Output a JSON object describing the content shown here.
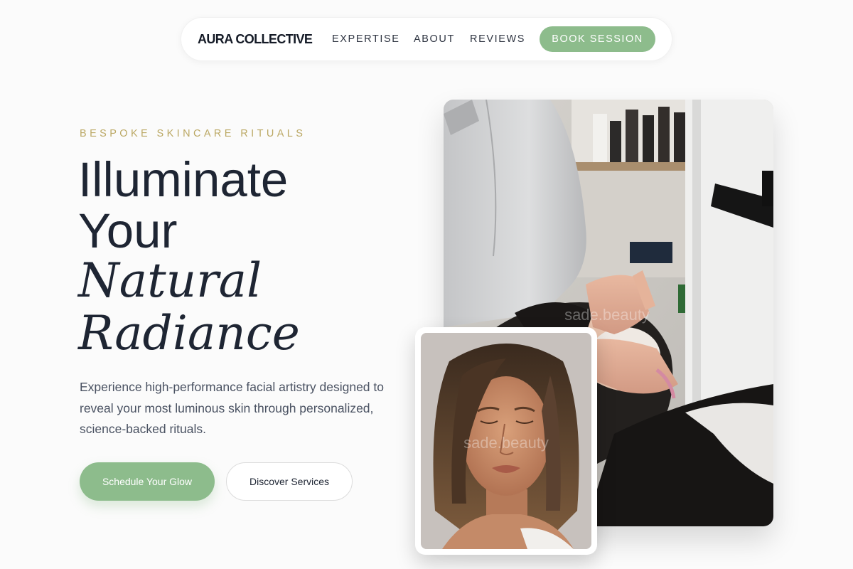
{
  "nav": {
    "logo": "AURA COLLECTIVE",
    "links": [
      "EXPERTISE",
      "ABOUT",
      "REVIEWS"
    ],
    "cta": "BOOK SESSION"
  },
  "hero": {
    "eyebrow": "BESPOKE SKINCARE RITUALS",
    "headline": [
      "Illuminate",
      "Your",
      "Natural",
      "Radiance"
    ],
    "description": "Experience high-performance facial artistry designed to reveal your most luminous skin through personalized, science-backed rituals.",
    "primary_button": "Schedule Your Glow",
    "secondary_button": "Discover Services"
  },
  "images": {
    "watermark": "sade.beauty"
  },
  "colors": {
    "accent": "#8dbc8c",
    "eyebrow": "#bba864",
    "text": "#1e2533"
  }
}
